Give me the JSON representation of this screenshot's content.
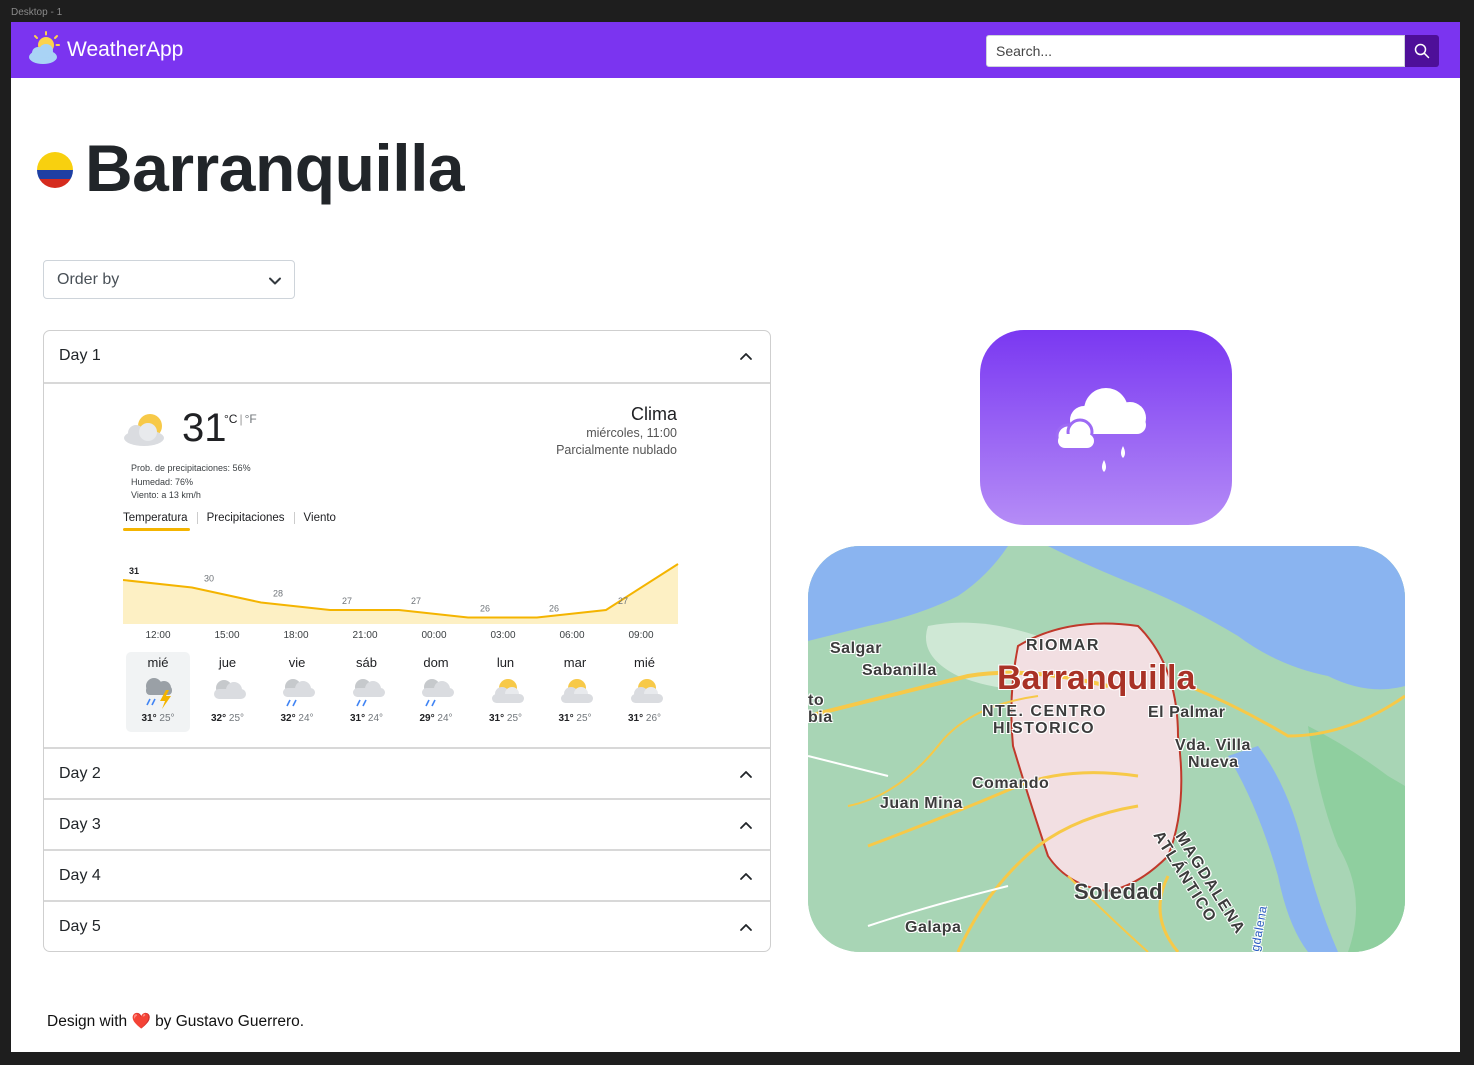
{
  "frame_label": "Desktop - 1",
  "navbar": {
    "brand": "WeatherApp",
    "brand_icon": "sun-cloud-icon",
    "search_placeholder": "Search...",
    "search_icon": "search-icon",
    "colors": {
      "bar": "#7b34f0",
      "button": "#4e0f99"
    }
  },
  "city": {
    "name": "Barranquilla",
    "flag": "colombia-flag"
  },
  "order_select": {
    "label": "Order by",
    "icon": "chevron-down-icon"
  },
  "accordion": {
    "items": [
      {
        "label": "Day 1",
        "open": true
      },
      {
        "label": "Day 2",
        "open": false
      },
      {
        "label": "Day 3",
        "open": false
      },
      {
        "label": "Day 4",
        "open": false
      },
      {
        "label": "Day 5",
        "open": false
      }
    ]
  },
  "weather_widget": {
    "temperature": "31",
    "unit_c": "°C",
    "unit_f": "°F",
    "precip": "Prob. de precipitaciones: 56%",
    "humidity": "Humedad: 76%",
    "wind": "Viento: a 13 km/h",
    "place_title": "Clima",
    "datetime": "miércoles, 11:00",
    "condition": "Parcialmente nublado",
    "tabs": [
      "Temperatura",
      "Precipitaciones",
      "Viento"
    ],
    "chart_values": [
      31,
      30,
      28,
      27,
      27,
      26,
      26,
      27
    ],
    "hours": [
      "12:00",
      "15:00",
      "18:00",
      "21:00",
      "00:00",
      "03:00",
      "06:00",
      "09:00"
    ],
    "days": [
      {
        "name": "mié",
        "hi": "31°",
        "lo": "25°",
        "icon": "thunderstorm-icon"
      },
      {
        "name": "jue",
        "hi": "32°",
        "lo": "25°",
        "icon": "cloudy-icon"
      },
      {
        "name": "vie",
        "hi": "32°",
        "lo": "24°",
        "icon": "rain-icon"
      },
      {
        "name": "sáb",
        "hi": "31°",
        "lo": "24°",
        "icon": "rain-icon"
      },
      {
        "name": "dom",
        "hi": "29°",
        "lo": "24°",
        "icon": "rain-icon"
      },
      {
        "name": "lun",
        "hi": "31°",
        "lo": "25°",
        "icon": "partly-cloudy-icon"
      },
      {
        "name": "mar",
        "hi": "31°",
        "lo": "25°",
        "icon": "partly-cloudy-icon"
      },
      {
        "name": "mié",
        "hi": "31°",
        "lo": "26°",
        "icon": "partly-cloudy-icon"
      }
    ]
  },
  "weather_card": {
    "icon": "rain-cloud-icon"
  },
  "map": {
    "labels": {
      "salgar": "Salgar",
      "sabanilla": "Sabanilla",
      "riomar": "RIOMAR",
      "barranquilla": "Barranquilla",
      "to": "to",
      "bia": "bia",
      "nte1": "NTE. CENTRO",
      "nte2": "HISTORICO",
      "el_palmar": "El Palmar",
      "villa1": "Vda. Villa",
      "villa2": "Nueva",
      "comando": "Comando",
      "juan_mina": "Juan Mina",
      "magdalena": "MAGDALENA",
      "atlantico": "ATLÁNTICO",
      "soledad": "Soledad",
      "galapa": "Galapa",
      "river": "gdalena"
    }
  },
  "footer": {
    "before": "Design with",
    "heart": "❤️",
    "after": "by Gustavo Guerrero."
  }
}
